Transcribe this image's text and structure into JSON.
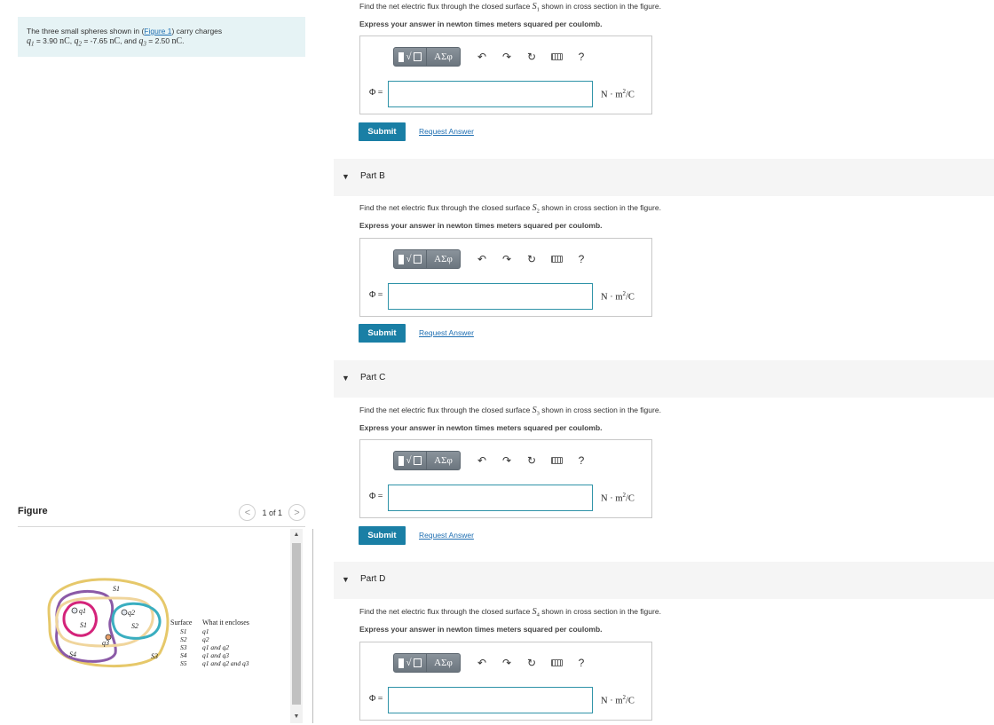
{
  "problem": {
    "intro": "The three small spheres shown in (",
    "figure_link": "Figure 1",
    "intro_end": ") carry charges",
    "q1_sym": "q",
    "q1_sub": "1",
    "q1_val": " = 3.90 ",
    "q2_sym": "q",
    "q2_sub": "2",
    "q2_val": " = -7.65 ",
    "q3_sym": "q",
    "q3_sub": "3",
    "q3_val": " = 2.50 ",
    "unit_nc": "nC",
    "sep1": ", ",
    "sep2": ", and ",
    "end": "."
  },
  "figure": {
    "title": "Figure",
    "pager_text": "1 of 1",
    "prev": "<",
    "next": ">",
    "scroll_up": "▲",
    "scroll_down": "▼",
    "table_header_surface": "Surface",
    "table_header_encloses": "What it encloses",
    "rows": [
      {
        "s": "S1",
        "e": "q1"
      },
      {
        "s": "S2",
        "e": "q2"
      },
      {
        "s": "S3",
        "e": "q1 and q2"
      },
      {
        "s": "S4",
        "e": "q1 and q3"
      },
      {
        "s": "S5",
        "e": "q1 and q2 and q3"
      }
    ],
    "labels": {
      "S1": "S1",
      "S2": "S2",
      "S3": "S3",
      "S4": "S4",
      "S5": "S5",
      "q1": "q1",
      "q2": "q2",
      "q3": "q3"
    },
    "colors": {
      "s1": "#d4237a",
      "s2": "#3aaec0",
      "s3": "#f0d59c",
      "s4": "#8b5aa7",
      "s5": "#e6c86a"
    }
  },
  "parts": [
    {
      "title": "",
      "q_pre": "Find the net electric flux through the closed surface ",
      "s_sym": "S",
      "s_sub": "1",
      "q_post": " shown in cross section in the figure.",
      "express": "Express your answer in newton times meters squared per coulomb."
    },
    {
      "title": "Part B",
      "q_pre": "Find the net electric flux through the closed surface ",
      "s_sym": "S",
      "s_sub": "2",
      "q_post": " shown in cross section in the figure.",
      "express": "Express your answer in newton times meters squared per coulomb."
    },
    {
      "title": "Part C",
      "q_pre": "Find the net electric flux through the closed surface ",
      "s_sym": "S",
      "s_sub": "3",
      "q_post": " shown in cross section in the figure.",
      "express": "Express your answer in newton times meters squared per coulomb."
    },
    {
      "title": "Part D",
      "q_pre": "Find the net electric flux through the closed surface ",
      "s_sym": "S",
      "s_sub": "4",
      "q_post": " shown in cross section in the figure.",
      "express": "Express your answer in newton times meters squared per coulomb."
    }
  ],
  "answer": {
    "phi_label": "Φ =",
    "unit_main": "N · m",
    "unit_sup": "2",
    "unit_end": "/C",
    "template_symbol": "√",
    "greek_symbol": "ΑΣφ",
    "undo": "↶",
    "redo": "↷",
    "reset": "↻",
    "help": "?",
    "submit": "Submit",
    "request": "Request Answer"
  }
}
